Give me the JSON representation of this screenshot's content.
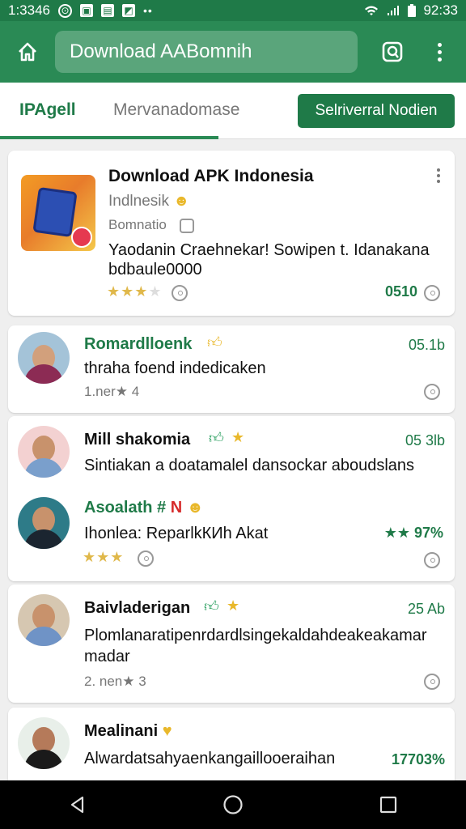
{
  "status_bar": {
    "time_left": "1:3346",
    "time_right": "92:33"
  },
  "app_bar": {
    "search_value": "Download AABomnih"
  },
  "tabs": [
    {
      "label": "IPAgell",
      "active": true
    },
    {
      "label": "Mervanadomase",
      "active": false
    }
  ],
  "tab_action_label": "Selriverral Nodien",
  "featured": {
    "title": "Download APK Indonesia",
    "subtitle": "Indlnesik",
    "meta": "Bomnatio",
    "description_line1": "Yaodanin Craehnekar! Sowipen t. Idanakana",
    "description_line2": "bdbaule0000",
    "rating_stars": 3.5,
    "count": "0510"
  },
  "posts": [
    {
      "name": "Romardlloenk",
      "time": "05.1b",
      "text": "thraha foend indedicaken",
      "meta": "1.ner★ 4"
    },
    {
      "name": "Mill shakomia",
      "time": "05 3lb",
      "text": "Sintiakan a doatamalel dansockar aboudslans"
    },
    {
      "name": "Asoalath",
      "tag": "N",
      "text": "Ihonlea: ReparlkКИh Akat",
      "score": "★★ 97%",
      "rating_stars": 3
    },
    {
      "name": "Baivladerigan",
      "time": "25 Ab",
      "text_line1": "Plomlanaratipenrdardlsingekaldahdeakeakamar",
      "text_line2": "madar",
      "meta": "2. nen★ 3"
    },
    {
      "name": "Mealinani",
      "text": "Alwardatsahyaenkangaillooeraihan",
      "score": "17703%"
    }
  ],
  "colors": {
    "primary": "#2a8a55",
    "primary_dark": "#1f7a48",
    "star": "#e0b84a",
    "badge": "#e53950"
  }
}
